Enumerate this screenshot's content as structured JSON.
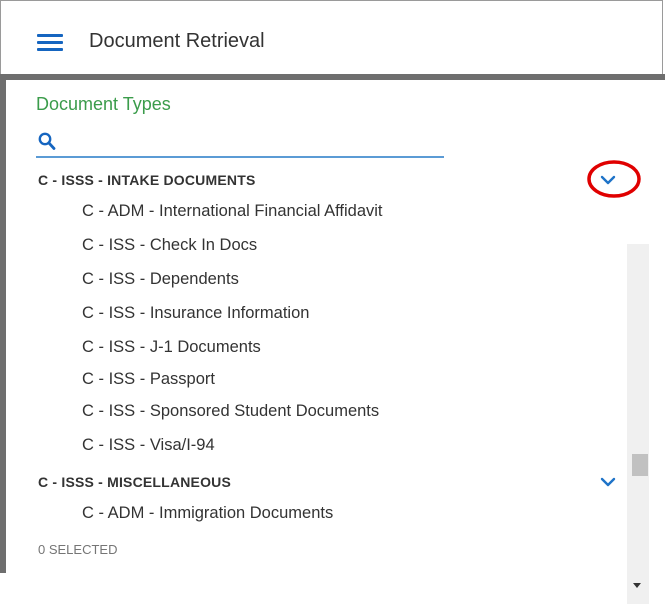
{
  "header": {
    "title": "Document Retrieval",
    "menu_icon": "hamburger-menu-icon",
    "accent_color": "#1565c0"
  },
  "panel": {
    "section_title": "Document Types",
    "section_title_color": "#3b9c4b",
    "search": {
      "value": "",
      "placeholder": "",
      "icon": "search-icon"
    },
    "groups": [
      {
        "label": "C - ISSS - INTAKE DOCUMENTS",
        "expanded": true,
        "items": [
          "C - ADM - International Financial Affidavit",
          "C - ISS - Check In Docs",
          "C - ISS - Dependents",
          "C - ISS - Insurance Information",
          "C - ISS - J-1 Documents",
          "C - ISS - Passport",
          "C - ISS - Sponsored Student Documents",
          "C - ISS - Visa/I-94"
        ]
      },
      {
        "label": "C - ISSS - MISCELLANEOUS",
        "expanded": true,
        "items": [
          "C - ADM - Immigration Documents"
        ]
      }
    ],
    "highlight_color": "#e00000",
    "selected_count": "0 SELECTED"
  }
}
